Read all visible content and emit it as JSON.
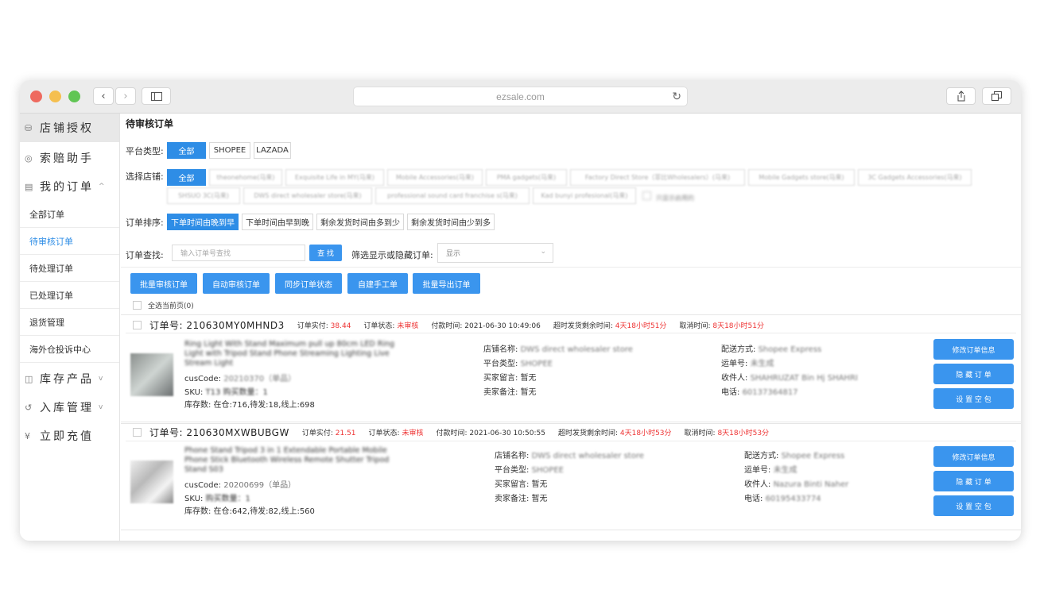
{
  "browser": {
    "url": "ezsale.com",
    "back": "‹",
    "forward": "›"
  },
  "sidebar": {
    "store_auth": "店铺授权",
    "claims": "索赔助手",
    "my_orders": "我的订单",
    "sub": [
      "全部订单",
      "待审核订单",
      "待处理订单",
      "已处理订单",
      "退货管理",
      "海外仓投诉中心"
    ],
    "inventory": "库存产品",
    "inbound": "入库管理",
    "recharge": "立即充值"
  },
  "page": {
    "title": "待审核订单",
    "platform_label": "平台类型:",
    "platforms": [
      "全部",
      "SHOPEE",
      "LAZADA"
    ],
    "store_label": "选择店铺:",
    "stores_row1": [
      "全部",
      "theonehome(马来)",
      "Exquisite Life in MY(马来)",
      "Mobile Accessories(马来)",
      "PMA gadgets(马来)",
      "Factory Direct Store（菲比Wholesalers）(马来)",
      "Mobile Gadgets store(马来)",
      "3C Gadgets Accessories(马来)"
    ],
    "stores_row2": [
      "SHSUO 3C(马来)",
      "DWS direct wholesaler store(马来)",
      "professional sound card franchise s(马来)",
      "Kad bunyi profesional(马来)",
      "只显示启用的"
    ],
    "sort_label": "订单排序:",
    "sorts": [
      "下单时间由晚到早",
      "下单时间由早到晚",
      "剩余发货时间由多到少",
      "剩余发货时间由少到多"
    ],
    "search_label": "订单查找:",
    "search_placeholder": "输入订单号查找",
    "search_btn": "查 找",
    "filter_label": "筛选显示或隐藏订单:",
    "filter_value": "显示",
    "actions": [
      "批量审核订单",
      "自动审核订单",
      "同步订单状态",
      "自建手工单",
      "批量导出订单"
    ],
    "select_all": "全选当前页(0)"
  },
  "orders": [
    {
      "order_label": "订单号:",
      "order_no": "210630MY0MHND3",
      "paid_label": "订单实付:",
      "paid": "38.44",
      "status_label": "订单状态:",
      "status": "未审核",
      "pay_time_label": "付款时间:",
      "pay_time": "2021-06-30 10:49:06",
      "ship_left_label": "超时发货剩余时间:",
      "ship_left": "4天18小时51分",
      "cancel_label": "取消时间:",
      "cancel": "8天18小时51分",
      "product_title": "Ring Light With Stand Maximum pull up 80cm LED Ring Light with Tripod Stand Phone Streaming Lighting Live Stream Light",
      "cuscode_label": "cusCode:",
      "cuscode": "20210370（单品）",
      "sku_label": "SKU:",
      "sku": "T13 购买数量：1",
      "stock": "库存数: 在仓:716,待发:18,线上:698",
      "store_name_label": "店铺名称:",
      "store_name": "DWS direct wholesaler store",
      "platform_label": "平台类型:",
      "platform": "SHOPEE",
      "buyer_msg_label": "买家留言:",
      "buyer_msg": "暂无",
      "seller_note_label": "卖家备注:",
      "seller_note": "暂无",
      "ship_method_label": "配送方式:",
      "ship_method": "Shopee Express",
      "tracking_label": "运单号:",
      "tracking": "未生成",
      "receiver_label": "收件人:",
      "receiver": "SHAHRUZAT Bin Hj SHAHRI",
      "phone_label": "电话:",
      "phone": "60137364817"
    },
    {
      "order_label": "订单号:",
      "order_no": "210630MXWBUBGW",
      "paid_label": "订单实付:",
      "paid": "21.51",
      "status_label": "订单状态:",
      "status": "未审核",
      "pay_time_label": "付款时间:",
      "pay_time": "2021-06-30 10:50:55",
      "ship_left_label": "超时发货剩余时间:",
      "ship_left": "4天18小时53分",
      "cancel_label": "取消时间:",
      "cancel": "8天18小时53分",
      "product_title": "Phone Stand Tripod 3 in 1 Extendable Portable Mobile Phone Stick Bluetooth Wireless Remote Shutter Tripod Stand S03",
      "cuscode_label": "cusCode:",
      "cuscode": "20200699（单品）",
      "sku_label": "SKU:",
      "sku": "购买数量：1",
      "stock": "库存数: 在仓:642,待发:82,线上:560",
      "store_name_label": "店铺名称:",
      "store_name": "DWS direct wholesaler store",
      "platform_label": "平台类型:",
      "platform": "SHOPEE",
      "buyer_msg_label": "买家留言:",
      "buyer_msg": "暂无",
      "seller_note_label": "卖家备注:",
      "seller_note": "暂无",
      "ship_method_label": "配送方式:",
      "ship_method": "Shopee Express",
      "tracking_label": "运单号:",
      "tracking": "未生成",
      "receiver_label": "收件人:",
      "receiver": "Nazura Binti Naher",
      "phone_label": "电话:",
      "phone": "60195433774"
    }
  ],
  "order_actions": [
    "修改订单信息",
    "隐 藏 订 单",
    "设 置 空 包"
  ]
}
